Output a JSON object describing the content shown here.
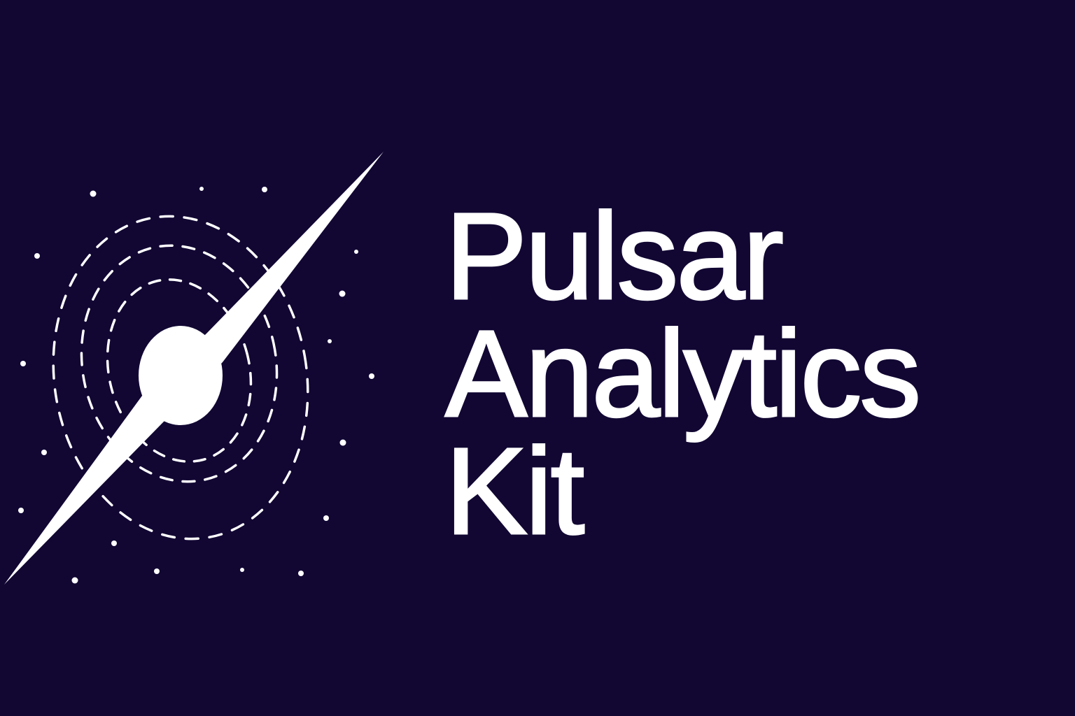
{
  "colors": {
    "background": "#120733",
    "foreground": "#ffffff"
  },
  "logo": {
    "icon": "pulsar-icon"
  },
  "wordmark": {
    "lines": [
      "Pulsar",
      "Analytics",
      "Kit"
    ]
  }
}
